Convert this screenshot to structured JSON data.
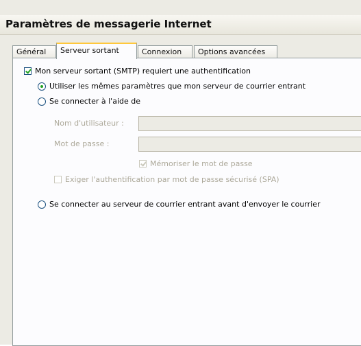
{
  "dialog": {
    "title": "Paramètres de messagerie Internet"
  },
  "tabs": [
    {
      "label": "Général",
      "active": false
    },
    {
      "label": "Serveur sortant",
      "active": true
    },
    {
      "label": "Connexion",
      "active": false
    },
    {
      "label": "Options avancées",
      "active": false
    }
  ],
  "outgoing": {
    "smtp_auth_label": "Mon serveur sortant (SMTP) requiert une authentification",
    "smtp_auth_checked": true,
    "same_settings_label": "Utiliser les mêmes paramètres que mon serveur de courrier entrant",
    "same_settings_selected": true,
    "log_on_using_label": "Se connecter à l'aide de",
    "log_on_using_selected": false,
    "username_label": "Nom d'utilisateur :",
    "username_value": "",
    "password_label": "Mot de passe :",
    "password_value": "",
    "remember_password_label": "Mémoriser le mot de passe",
    "remember_password_checked": true,
    "spa_label": "Exiger l'authentification par mot de passe sécurisé (SPA)",
    "spa_checked": false,
    "log_on_incoming_label": "Se connecter au serveur de courrier entrant avant d'envoyer le courrier",
    "log_on_incoming_selected": false
  },
  "colors": {
    "active_tab_accent": "#ffc83c",
    "check_mark": "#21a121",
    "disabled_text": "#aca899",
    "dialog_background": "#ecebe4"
  }
}
